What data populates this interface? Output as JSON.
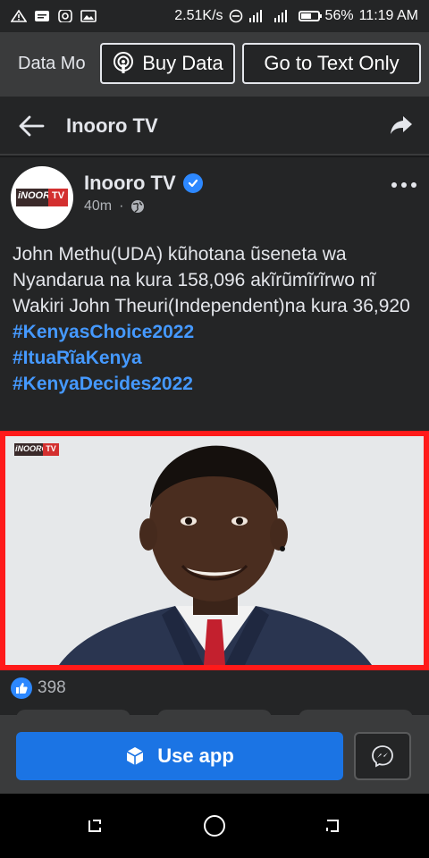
{
  "status_bar": {
    "net_speed": "2.51K/s",
    "battery": "56%",
    "time": "11:19 AM"
  },
  "data_mode": {
    "label": "Data Mo",
    "buy_data_label": "Buy Data",
    "text_only_label": "Go to Text Only"
  },
  "header": {
    "title": "Inooro TV"
  },
  "post": {
    "author": "Inooro TV",
    "time": "40m",
    "separator": "·",
    "body": "John Methu(UDA) kũhotana ũseneta wa Nyandarua na kura 158,096 akĩrũmĩrĩrwo nĩ Wakiri John Theuri(Independent)na kura 36,920",
    "hashtags": [
      "#KenyasChoice2022",
      "#ItuaRĩaKenya",
      "#KenyaDecides2022"
    ],
    "logo_text_left": "iNOORO",
    "logo_text_right": "TV",
    "like_count": "398"
  },
  "app_bar": {
    "use_app_label": "Use app"
  },
  "colors": {
    "accent": "#1b74e4",
    "link": "#4599ff",
    "highlight_border": "#ff1a1a"
  }
}
